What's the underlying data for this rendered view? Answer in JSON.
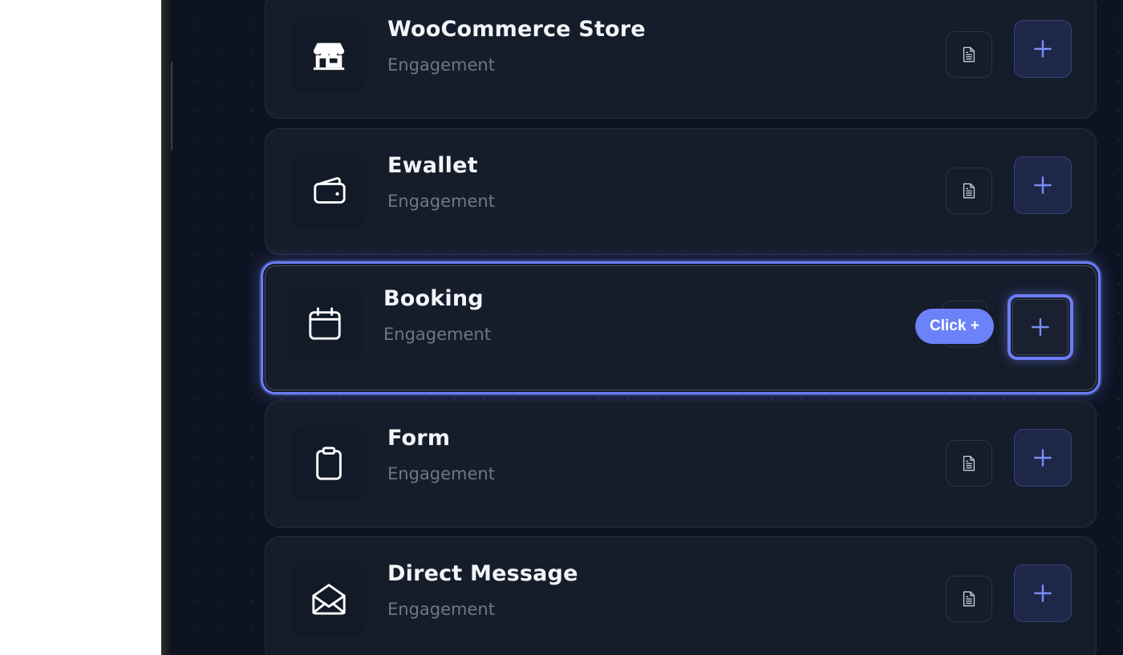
{
  "cards": [
    {
      "title": "WooCommerce Store",
      "subtitle": "Engagement",
      "icon": "store-icon",
      "selected": false
    },
    {
      "title": "Ewallet",
      "subtitle": "Engagement",
      "icon": "wallet-icon",
      "selected": false
    },
    {
      "title": "Booking",
      "subtitle": "Engagement",
      "icon": "calendar-icon",
      "selected": true
    },
    {
      "title": "Form",
      "subtitle": "Engagement",
      "icon": "clipboard-icon",
      "selected": false
    },
    {
      "title": "Direct Message",
      "subtitle": "Engagement",
      "icon": "envelope-open-icon",
      "selected": false
    }
  ],
  "hint": {
    "label": "Click +"
  },
  "colors": {
    "background": "#0d1320",
    "card": "#151c2a",
    "accent": "#6b7df5",
    "text": "#f3f5f9",
    "muted": "#6e7687"
  }
}
